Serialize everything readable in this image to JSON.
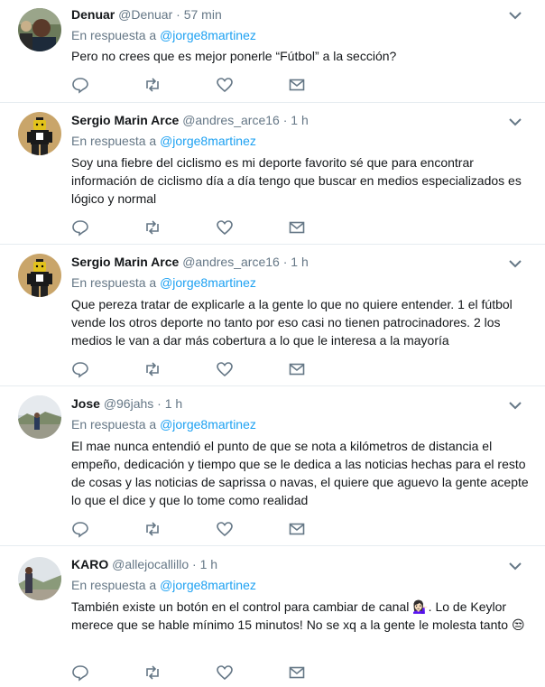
{
  "reply_prefix": "En respuesta a",
  "tweets": [
    {
      "name": "Denuar",
      "handle": "@Denuar",
      "separator": "·",
      "time": "57 min",
      "reply_to": "@jorge8martinez",
      "text": "Pero no crees que es mejor ponerle “Fútbol” a la sección?",
      "avatar_icon": "person-photo"
    },
    {
      "name": "Sergio Marin Arce",
      "handle": "@andres_arce16",
      "separator": "·",
      "time": "1 h",
      "reply_to": "@jorge8martinez",
      "text": "Soy una fiebre del ciclismo es mi deporte favorito sé que para encontrar información de ciclismo día a día tengo que buscar en medios especializados es lógico y normal",
      "avatar_icon": "lego-figure"
    },
    {
      "name": "Sergio Marin Arce",
      "handle": "@andres_arce16",
      "separator": "·",
      "time": "1 h",
      "reply_to": "@jorge8martinez",
      "text": "Que pereza tratar de explicarle a la gente lo que no quiere entender. 1 el fútbol vende los otros deporte no tanto por eso casi no tienen patrocinadores. 2 los medios le van a dar más cobertura a lo que le interesa a la mayoría",
      "avatar_icon": "lego-figure"
    },
    {
      "name": "Jose",
      "handle": "@96jahs",
      "separator": "·",
      "time": "1 h",
      "reply_to": "@jorge8martinez",
      "text": "El mae nunca entendió el punto de que se nota a kilómetros de distancia el empeño, dedicación y tiempo que se le dedica a las noticias hechas para el resto de cosas y las noticias de saprissa o navas, el quiere que aguevo la gente acepte lo que el dice y que lo tome como realidad",
      "avatar_icon": "landscape-photo"
    },
    {
      "name": "KARO",
      "handle": "@allejocallillo",
      "separator": "·",
      "time": "1 h",
      "reply_to": "@jorge8martinez",
      "text_before_emoji": "También existe un botón en el control para cambiar de canal ",
      "emoji1": "💁🏻‍♀️",
      "text_after_emoji": ". Lo de Keylor merece que se hable mínimo 15 minutos! No se xq a la gente le molesta tanto ",
      "emoji2": "😒",
      "avatar_icon": "person-outdoor-photo"
    }
  ]
}
